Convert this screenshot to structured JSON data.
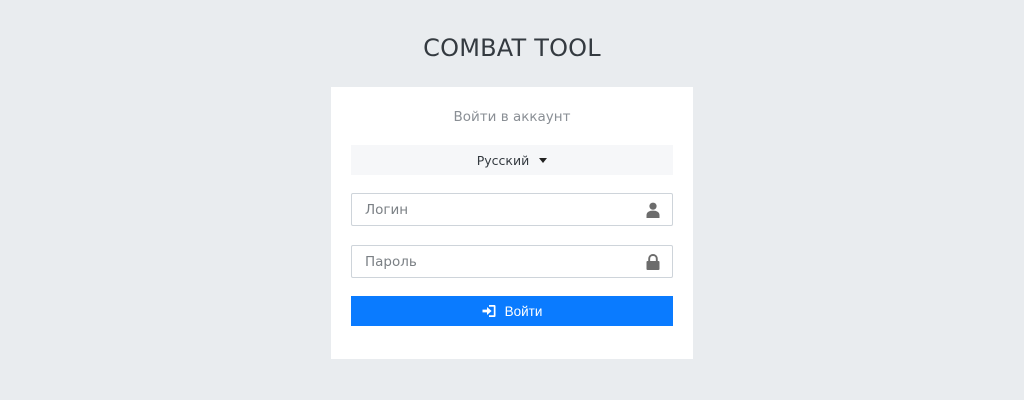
{
  "app": {
    "title": "COMBAT TOOL"
  },
  "login_card": {
    "subtitle": "Войти в аккаунт",
    "language": {
      "selected": "Русский"
    },
    "login_field": {
      "placeholder": "Логин",
      "value": "",
      "icon": "user-icon"
    },
    "password_field": {
      "placeholder": "Пароль",
      "value": "",
      "icon": "lock-icon"
    },
    "submit": {
      "label": "Войти",
      "icon": "sign-in-icon"
    }
  },
  "colors": {
    "background": "#e9ecef",
    "card": "#ffffff",
    "primary": "#0a7bff",
    "icon": "#6c6c6c"
  }
}
